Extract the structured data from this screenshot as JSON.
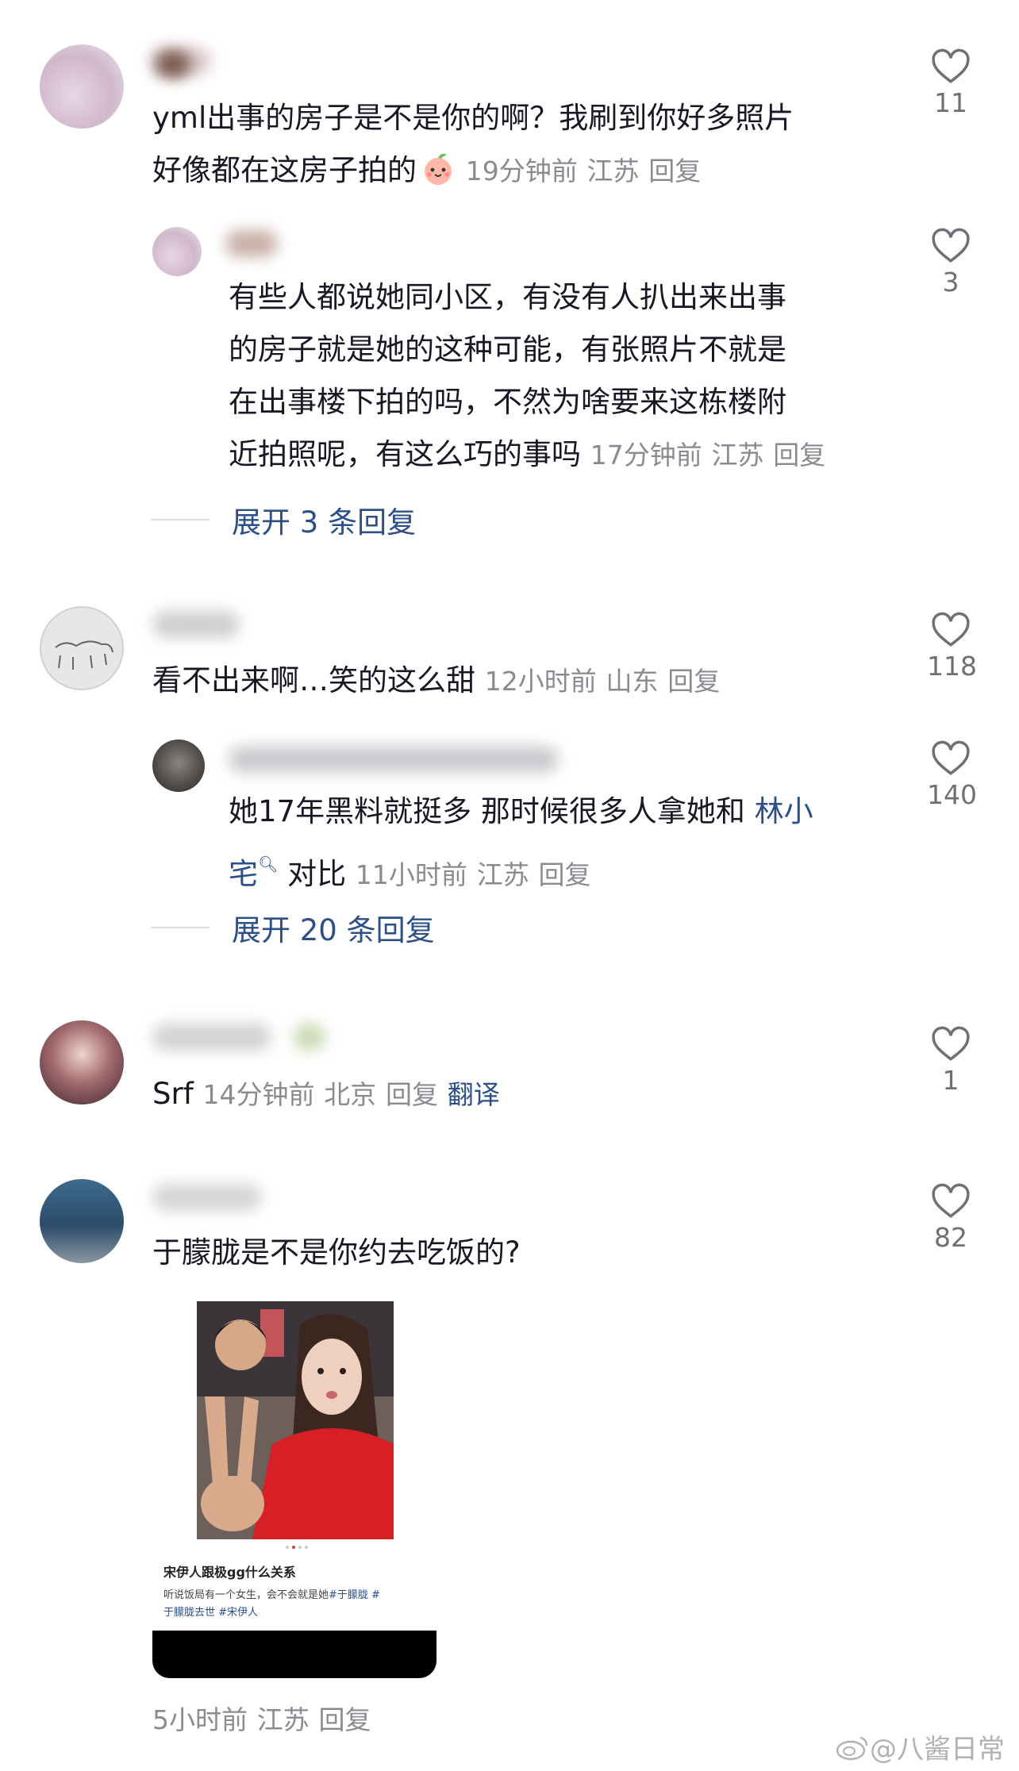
{
  "comments": [
    {
      "text_line1": "yml出事的房子是不是你的啊？我刷到你好多照片",
      "text_line2": "好像都在这房子拍的",
      "emoji": "peach-face-emoji",
      "time": "19分钟前",
      "location": "江苏",
      "reply": "回复",
      "likes": "11"
    },
    {
      "lines": [
        "有些人都说她同小区，有没有人扒出来出事",
        "的房子就是她的这种可能，有张照片不就是",
        "在出事楼下拍的吗，不然为啥要来这栋楼附",
        "近拍照呢，有这么巧的事吗"
      ],
      "time": "17分钟前",
      "location": "江苏",
      "reply": "回复",
      "likes": "3"
    },
    {
      "text": "看不出来啊…笑的这么甜",
      "time": "12小时前",
      "location": "山东",
      "reply": "回复",
      "likes": "118"
    },
    {
      "text_line1_pre": "她17年黑料就挺多 那时候很多人拿她和 ",
      "link_part1": "林小",
      "link_part2": "宅",
      "text_line2_post": " 对比",
      "time": "11小时前",
      "location": "江苏",
      "reply": "回复",
      "likes": "140"
    },
    {
      "text": "Srf",
      "time": "14分钟前",
      "location": "北京",
      "reply": "回复",
      "translate": "翻译",
      "likes": "1"
    },
    {
      "text": "于朦胧是不是你约去吃饭的?",
      "time": "5小时前",
      "location": "江苏",
      "reply": "回复",
      "likes": "82"
    }
  ],
  "expands": [
    {
      "label": "展开 3 条回复"
    },
    {
      "label": "展开 20 条回复"
    }
  ],
  "post_card": {
    "title": "宋伊人跟极gg什么关系",
    "body": "听说饭局有一个女生，会不会就是她",
    "tag1": "#于朦胧 #",
    "tag2": "于朦胧去世 #宋伊人"
  },
  "watermark": "@八酱日常",
  "colors": {
    "link": "#2b4f86",
    "meta": "#8a8b91",
    "text": "#161823"
  }
}
